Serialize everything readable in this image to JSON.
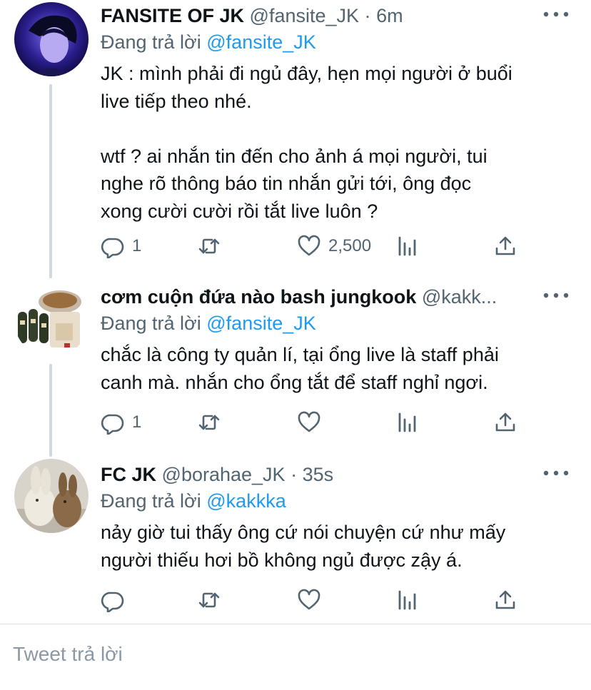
{
  "tweets": [
    {
      "name": "FANSITE OF JK",
      "handle": "@fansite_JK",
      "sep": "·",
      "time": "6m",
      "reply_prefix": "Đang trả lời ",
      "reply_to": "@fansite_JK",
      "text": "JK : mình phải đi ngủ đây, hẹn mọi người ở buổi\nlive tiếp theo nhé.\n\nwtf ? ai nhắn tin đến cho ảnh á mọi người, tui\nnghe rõ thông báo tin nhắn gửi tới, ông đọc\nxong cười cười rồi tắt live luôn ?",
      "reply_count": "1",
      "retweet_count": "",
      "like_count": "2,500"
    },
    {
      "name": "cơm cuộn đứa nào bash jungkook",
      "handle": "@kakk...",
      "sep": "",
      "time": "",
      "reply_prefix": "Đang trả lời ",
      "reply_to": "@fansite_JK",
      "text": "chắc là công ty quản lí, tại ổng live là staff phải\ncanh mà. nhắn cho ổng tắt để staff nghỉ ngơi.",
      "reply_count": "1",
      "retweet_count": "",
      "like_count": ""
    },
    {
      "name": "FC JK",
      "handle": "@borahae_JK",
      "sep": "·",
      "time": "35s",
      "reply_prefix": "Đang trả lời ",
      "reply_to": "@kakkka",
      "text": "nảy giờ tui thấy ông cứ nói chuyện cứ như mấy\nngười thiếu hơi bồ không ngủ được zậy á.",
      "reply_count": "",
      "retweet_count": "",
      "like_count": ""
    }
  ],
  "composer": {
    "placeholder": "Tweet trả lời"
  },
  "icons": [
    "more-icon",
    "reply-icon",
    "retweet-icon",
    "like-icon",
    "analytics-icon",
    "share-icon"
  ],
  "colors": {
    "mention": "#1d9bf0",
    "secondary": "#536471",
    "text": "#0f1419",
    "thread_line": "#cfd9de"
  }
}
